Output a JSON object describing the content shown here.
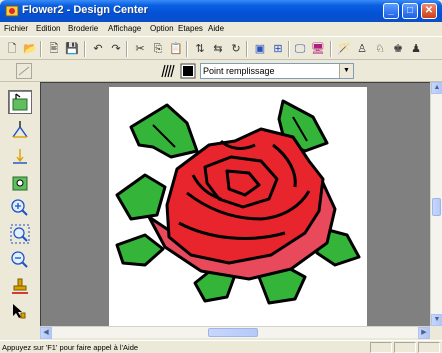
{
  "window": {
    "title": "Flower2 - Design Center",
    "minimize_label": "_",
    "maximize_label": "□",
    "close_label": "✕"
  },
  "menu": [
    "Fichier",
    "Edition",
    "Broderie",
    "Affichage",
    "Option",
    "Etapes",
    "Aide"
  ],
  "toolbar2": {
    "fill_type_selected": "Point remplissage",
    "dropdown_arrow": "▼"
  },
  "scrollbars": {
    "up": "▲",
    "down": "▼",
    "left": "◀",
    "right": "▶"
  },
  "status": {
    "text": "Appuyez sur 'F1' pour faire appel à l'Aide"
  },
  "colors": {
    "petal_red": "#e8252c",
    "petal_pink": "#e84a5c",
    "leaf_green": "#34b53a",
    "outline": "#000000",
    "canvas": "#ffffff",
    "workspace": "#808080"
  }
}
